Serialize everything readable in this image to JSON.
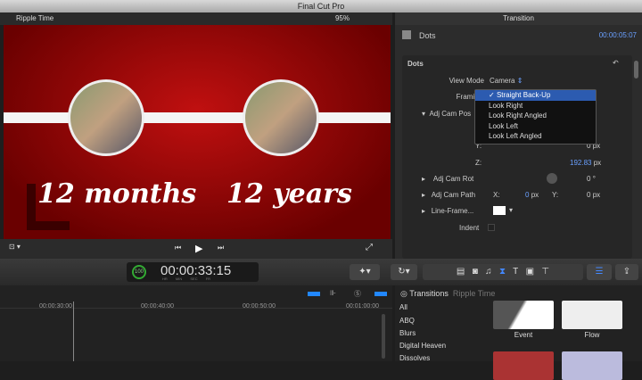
{
  "app": {
    "title": "Final Cut Pro"
  },
  "viewer": {
    "clip": "Ripple Time",
    "zoom": "95%",
    "caption_left": "12 months",
    "caption_right": "12 years"
  },
  "inspector": {
    "tab": "Transition",
    "name": "Dots",
    "timecode": "00:00:05:07",
    "section": "Dots",
    "view_mode_label": "View Mode",
    "view_mode": "Camera",
    "framing_label": "Framing",
    "adj_cam_pos": "Adj Cam Pos",
    "x_label": "X:",
    "y_label": "Y:",
    "z_label": "Z:",
    "y_value": "0",
    "z_value": "192.83",
    "unit": "px",
    "adj_cam_rot": "Adj Cam Rot",
    "rot_value": "0",
    "deg": "°",
    "adj_cam_path": "Adj Cam Path",
    "path_x": "0",
    "path_y": "0",
    "line_frame": "Line-Frame...",
    "indent": "Indent",
    "framing_options": [
      "Straight Back-Up",
      "Look Right",
      "Look Right Angled",
      "Look Left",
      "Look Left Angled"
    ],
    "selected": 0
  },
  "timecode": {
    "percent": "100",
    "value": "00:00:33:15",
    "units": [
      "HR",
      "MIN",
      "SEC",
      "FR"
    ]
  },
  "timeline": {
    "ticks": [
      "00:00:30:00",
      "00:00:40:00",
      "00:00:50:00",
      "00:01:00:00"
    ]
  },
  "browser": {
    "title": "Transitions",
    "subtitle": "Ripple Time",
    "categories": [
      "All",
      "ABQ",
      "Blurs",
      "Digital Heaven",
      "Dissolves"
    ],
    "items": [
      "Event",
      "Flow"
    ]
  }
}
